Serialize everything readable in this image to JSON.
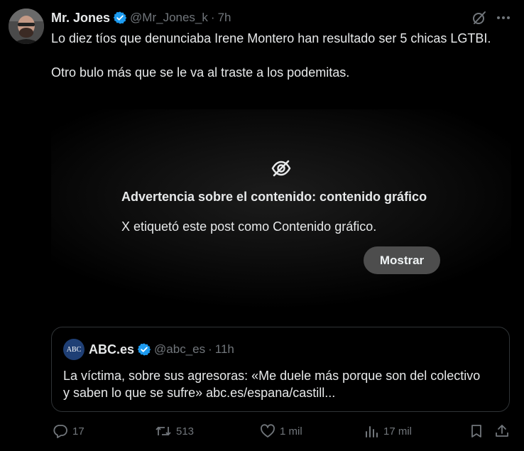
{
  "tweet": {
    "author_name": "Mr. Jones",
    "handle": "@Mr_Jones_k",
    "separator": "·",
    "time": "7h",
    "text_line1": "Lo diez tíos que denunciaba Irene Montero han resultado ser 5 chicas LGTBI.",
    "text_line2": "Otro bulo más que se le va al traste a los podemitas."
  },
  "media_warning": {
    "title": "Advertencia sobre el contenido: contenido gráfico",
    "text": "X etiquetó este post como Contenido gráfico.",
    "button_label": "Mostrar"
  },
  "quote": {
    "logo_text": "ABC",
    "author_name": "ABC.es",
    "handle": "@abc_es",
    "separator": "·",
    "time": "11h",
    "text": "La víctima, sobre sus agresoras: «Me duele más porque son del colectivo y saben lo que se sufre» abc.es/espana/castill..."
  },
  "actions": {
    "replies": "17",
    "reposts": "513",
    "likes": "1 mil",
    "views": "17 mil"
  },
  "colors": {
    "background": "#000000",
    "text": "#e7e9ea",
    "muted": "#71767b",
    "verified": "#1d9bf0",
    "button_bg": "#4d4d4d",
    "border": "#2f3336"
  }
}
